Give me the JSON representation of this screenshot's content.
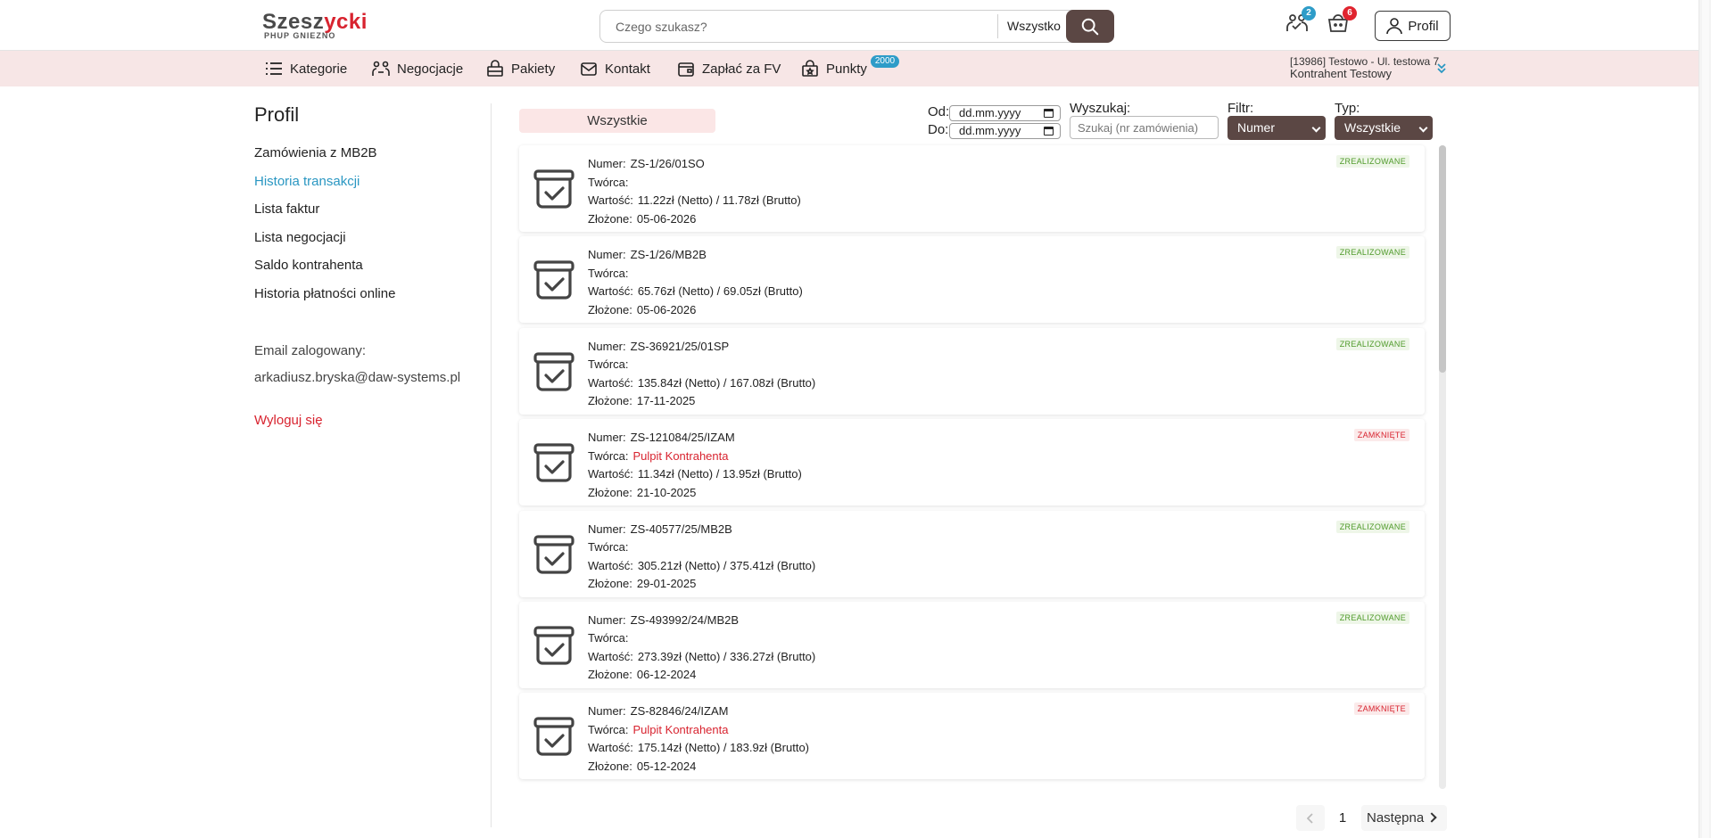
{
  "header": {
    "logo_main_a": "Szesz",
    "logo_main_b": "ycki",
    "logo_sub": "PHUP GNIEZNO",
    "search_placeholder": "Czego szukasz?",
    "search_scope": "Wszystko",
    "negotiations_badge": "2",
    "cart_badge": "6",
    "profile_label": "Profil"
  },
  "nav": {
    "items": [
      {
        "label": "Kategorie",
        "icon": "list-icon"
      },
      {
        "label": "Negocjacje",
        "icon": "negotiation-icon"
      },
      {
        "label": "Pakiety",
        "icon": "package-icon"
      },
      {
        "label": "Kontakt",
        "icon": "mail-icon"
      },
      {
        "label": "Zapłać za FV",
        "icon": "wallet-icon"
      },
      {
        "label": "Punkty",
        "icon": "points-icon",
        "badge": "2000"
      }
    ],
    "contractor_line1": "[13986] Testowo - Ul. testowa 7",
    "contractor_line2": "Kontrahent Testowy"
  },
  "sidebar": {
    "title": "Profil",
    "links": [
      {
        "label": "Zamówienia z MB2B",
        "active": false
      },
      {
        "label": "Historia transakcji",
        "active": true
      },
      {
        "label": "Lista faktur",
        "active": false
      },
      {
        "label": "Lista negocjacji",
        "active": false
      },
      {
        "label": "Saldo kontrahenta",
        "active": false
      },
      {
        "label": "Historia płatności online",
        "active": false
      }
    ],
    "email_label": "Email zalogowany:",
    "email": "arkadiusz.bryska@daw-systems.pl",
    "logout": "Wyloguj się"
  },
  "filters": {
    "tab_all": "Wszystkie",
    "from_label": "Od:",
    "to_label": "Do:",
    "date_placeholder": "dd.mm.yyyy",
    "search_label": "Wyszukaj:",
    "search_placeholder": "Szukaj (nr zamówienia)",
    "filter_label": "Filtr:",
    "filter_value": "Numer",
    "type_label": "Typ:",
    "type_value": "Wszystkie"
  },
  "labels": {
    "numer": "Numer:",
    "tworca": "Twórca:",
    "wartosc": "Wartość:",
    "zlozone": "Złożone:"
  },
  "orders": [
    {
      "numer": "ZS-1/26/01SO",
      "tworca": "",
      "wartosc": "11.22zł (Netto) / 11.78zł (Brutto)",
      "zlozone": "05-06-2026",
      "status": "ZREALIZOWANE",
      "status_type": "ok"
    },
    {
      "numer": "ZS-1/26/MB2B",
      "tworca": "",
      "wartosc": "65.76zł (Netto) / 69.05zł (Brutto)",
      "zlozone": "05-06-2026",
      "status": "ZREALIZOWANE",
      "status_type": "ok"
    },
    {
      "numer": "ZS-36921/25/01SP",
      "tworca": "",
      "wartosc": "135.84zł (Netto) / 167.08zł (Brutto)",
      "zlozone": "17-11-2025",
      "status": "ZREALIZOWANE",
      "status_type": "ok"
    },
    {
      "numer": "ZS-121084/25/IZAM",
      "tworca": "Pulpit Kontrahenta",
      "wartosc": "11.34zł (Netto) / 13.95zł (Brutto)",
      "zlozone": "21-10-2025",
      "status": "ZAMKNIĘTE",
      "status_type": "closed"
    },
    {
      "numer": "ZS-40577/25/MB2B",
      "tworca": "",
      "wartosc": "305.21zł (Netto) / 375.41zł (Brutto)",
      "zlozone": "29-01-2025",
      "status": "ZREALIZOWANE",
      "status_type": "ok"
    },
    {
      "numer": "ZS-493992/24/MB2B",
      "tworca": "",
      "wartosc": "273.39zł (Netto) / 336.27zł (Brutto)",
      "zlozone": "06-12-2024",
      "status": "ZREALIZOWANE",
      "status_type": "ok"
    },
    {
      "numer": "ZS-82846/24/IZAM",
      "tworca": "Pulpit Kontrahenta",
      "wartosc": "175.14zł (Netto) / 183.9zł (Brutto)",
      "zlozone": "05-12-2024",
      "status": "ZAMKNIĘTE",
      "status_type": "closed"
    }
  ],
  "pager": {
    "page": "1",
    "next_label": "Następna"
  }
}
